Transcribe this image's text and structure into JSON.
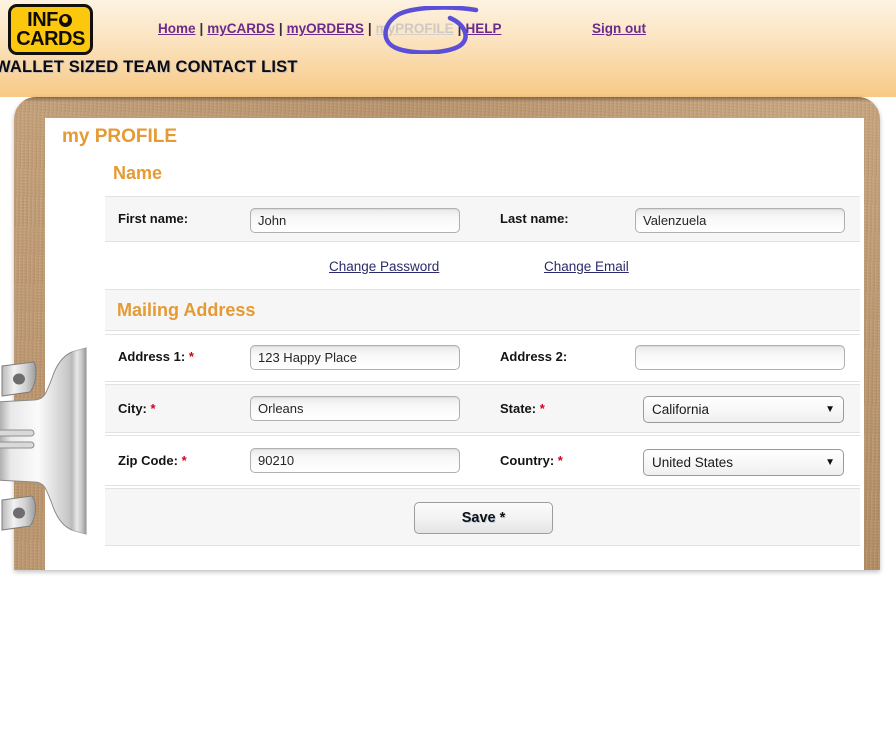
{
  "header": {
    "logo": {
      "line1": "INF",
      "line1_suffix": "O",
      "line2": "CARDS",
      "name": "INFO CARDS"
    },
    "nav": [
      {
        "label": "Home",
        "state": "enabled"
      },
      {
        "label": "myCARDS",
        "state": "enabled"
      },
      {
        "label": "myORDERS",
        "state": "enabled"
      },
      {
        "label": "myPROFILE",
        "state": "disabled"
      },
      {
        "label": "HELP",
        "state": "enabled"
      }
    ],
    "separator": "|",
    "signout_label": "Sign out",
    "tagline": "WALLET SIZED TEAM CONTACT LIST",
    "annotation": {
      "type": "hand-drawn-circle",
      "target": "myPROFILE",
      "color": "#5a4fd6"
    }
  },
  "page": {
    "title_prefix": "my ",
    "title_main": "PROFILE",
    "title_full": "my PROFILE"
  },
  "sections": {
    "name": {
      "heading": "Name",
      "fields": [
        {
          "label": "First name:",
          "value": "John",
          "required": false
        },
        {
          "label": "Last name:",
          "value": "Valenzuela",
          "required": false
        }
      ],
      "links": [
        {
          "label": "Change Password"
        },
        {
          "label": "Change Email"
        }
      ]
    },
    "mailing_address": {
      "heading": "Mailing Address",
      "required_marker": "*",
      "fields": [
        {
          "label": "Address 1:",
          "value": "123 Happy Place",
          "required": true,
          "type": "text"
        },
        {
          "label": "Address 2:",
          "value": "",
          "required": false,
          "type": "text"
        },
        {
          "label": "City:",
          "value": "Orleans",
          "required": true,
          "type": "text"
        },
        {
          "label": "State:",
          "value": "California",
          "required": true,
          "type": "select"
        },
        {
          "label": "Zip Code:",
          "value": "90210",
          "required": true,
          "type": "text"
        },
        {
          "label": "Country:",
          "value": "United States",
          "required": true,
          "type": "select"
        }
      ]
    }
  },
  "actions": {
    "save_label": "Save",
    "save_marker": "*"
  },
  "colors": {
    "accent_orange": "#e59a33",
    "logo_yellow": "#fcc80d",
    "link_purple": "#6b2b8d",
    "required_red": "#d0021b",
    "annotation_blue": "#5a4fd6",
    "clipboard_brown": "#b8926a"
  }
}
